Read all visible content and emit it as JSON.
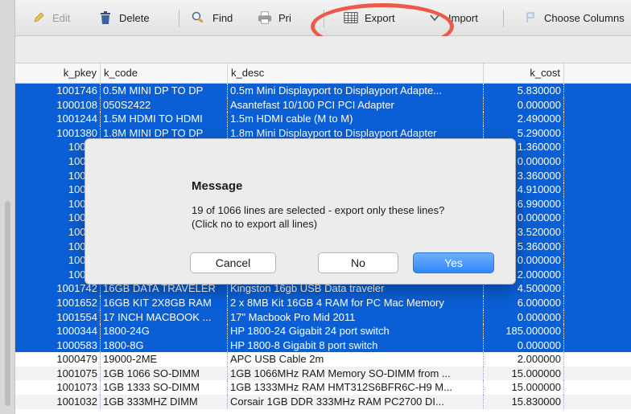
{
  "toolbar": {
    "edit": "Edit",
    "delete": "Delete",
    "find": "Find",
    "print": "Pri",
    "export": "Export",
    "import": "Import",
    "choose_columns": "Choose Columns"
  },
  "table": {
    "columns": [
      "k_pkey",
      "k_code",
      "k_desc",
      "k_cost"
    ],
    "rows": [
      {
        "pkey": "1001746",
        "code": "0.5M MINI DP TO DP",
        "desc": "0.5m Mini Displayport to Displayport Adapte...",
        "cost": "5.830000",
        "selected": true
      },
      {
        "pkey": "1000108",
        "code": "050S2422",
        "desc": "Asantefast 10/100 PCI PCI Adapter",
        "cost": "0.000000",
        "selected": true
      },
      {
        "pkey": "1001244",
        "code": "1.5M HDMI TO HDMI",
        "desc": "1.5m HDMI cable (M to M)",
        "cost": "2.490000",
        "selected": true
      },
      {
        "pkey": "1001380",
        "code": "1.8M MINI DP TO DP",
        "desc": "1.8m Mini Displayport to Displayport Adapter",
        "cost": "5.290000",
        "selected": true
      },
      {
        "pkey": "10017",
        "code": "",
        "desc": "",
        "cost": "1.360000",
        "selected": true
      },
      {
        "pkey": "10012",
        "code": "",
        "desc": "",
        "cost": "0.000000",
        "selected": true
      },
      {
        "pkey": "10008",
        "code": "",
        "desc": "",
        "cost": "3.360000",
        "selected": true
      },
      {
        "pkey": "10001",
        "code": "",
        "desc": "",
        "cost": "4.910000",
        "selected": true
      },
      {
        "pkey": "10002",
        "code": "",
        "desc": "",
        "cost": "6.990000",
        "selected": true
      },
      {
        "pkey": "10006",
        "code": "",
        "desc": "",
        "cost": "0.000000",
        "selected": true
      },
      {
        "pkey": "10003",
        "code": "",
        "desc": "",
        "cost": "3.520000",
        "selected": true
      },
      {
        "pkey": "10009",
        "code": "",
        "desc": "",
        "cost": "5.360000",
        "selected": true
      },
      {
        "pkey": "10016",
        "code": "",
        "desc": "",
        "cost": "0.000000",
        "selected": true
      },
      {
        "pkey": "10004",
        "code": "",
        "desc": "",
        "cost": "2.000000",
        "selected": true
      },
      {
        "pkey": "1001742",
        "code": "16GB DATA TRAVELER",
        "desc": "Kingston 16gb USB Data traveler",
        "cost": "4.500000",
        "selected": true
      },
      {
        "pkey": "1001652",
        "code": "16GB KIT 2X8GB RAM",
        "desc": "2 x 8MB Kit 16GB 4 RAM for PC Mac Memory",
        "cost": "6.000000",
        "selected": true
      },
      {
        "pkey": "1001554",
        "code": "17 INCH MACBOOK ...",
        "desc": "17\" Macbook Pro Mid 2011",
        "cost": "0.000000",
        "selected": true
      },
      {
        "pkey": "1000344",
        "code": "1800-24G",
        "desc": "HP 1800-24 Gigabit 24 port switch",
        "cost": "185.000000",
        "selected": true
      },
      {
        "pkey": "1000583",
        "code": "1800-8G",
        "desc": "HP 1800-8 Gigabit 8 port switch",
        "cost": "0.000000",
        "selected": true
      },
      {
        "pkey": "1000479",
        "code": "19000-2ME",
        "desc": "APC USB Cable 2m",
        "cost": "2.000000",
        "selected": false
      },
      {
        "pkey": "1001075",
        "code": "1GB 1066 SO-DIMM",
        "desc": "1GB 1066MHz RAM Memory SO-DIMM from ...",
        "cost": "15.000000",
        "selected": false
      },
      {
        "pkey": "1001073",
        "code": "1GB 1333 SO-DIMM",
        "desc": "1GB 1333MHz RAM HMT312S6BFR6C-H9 M...",
        "cost": "15.000000",
        "selected": false
      },
      {
        "pkey": "1001032",
        "code": "1GB 333MHZ DIMM",
        "desc": "Corsair 1GB DDR 333MHz RAM  PC2700 DI...",
        "cost": "15.830000",
        "selected": false
      }
    ]
  },
  "dialog": {
    "title": "Message",
    "line1": "19 of 1066 lines are selected - export only these lines?",
    "line2": "(Click no to export all lines)",
    "cancel": "Cancel",
    "no": "No",
    "yes": "Yes"
  },
  "colors": {
    "selection": "#0a5fd6",
    "highlight_ring": "#ec5a4a",
    "primary_button": "#2f86f6"
  }
}
